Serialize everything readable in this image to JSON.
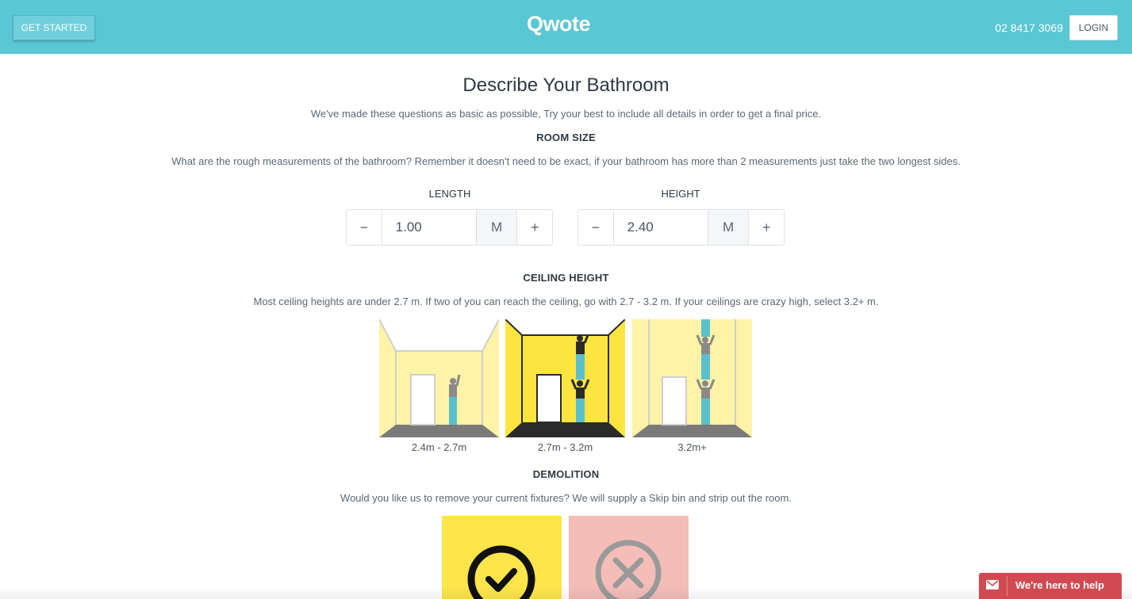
{
  "header": {
    "get_started": "GET STARTED",
    "logo": "Qwote",
    "phone": "02 8417 3069",
    "login": "LOGIN",
    "bg_color": "#5ac7d4"
  },
  "page": {
    "title": "Describe Your Bathroom",
    "subtitle": "We've made these questions as basic as possible, Try your best to include all details in order to get a final price."
  },
  "room_size": {
    "heading": "ROOM SIZE",
    "description": "What are the rough measurements of the bathroom? Remember it doesn't need to be exact, if your bathroom has more than 2 measurements just take the two longest sides.",
    "length": {
      "label": "LENGTH",
      "minus": "−",
      "value": "1.00",
      "unit": "M",
      "plus": "+"
    },
    "height": {
      "label": "HEIGHT",
      "minus": "−",
      "value": "2.40",
      "unit": "M",
      "plus": "+"
    }
  },
  "ceiling_height": {
    "heading": "CEILING HEIGHT",
    "description": "Most ceiling heights are under 2.7 m. If two of you can reach the ceiling, go with 2.7 - 3.2 m. If your ceilings are crazy high, select 3.2+ m.",
    "options": [
      {
        "label": "2.4m - 2.7m",
        "selected": false
      },
      {
        "label": "2.7m - 3.2m",
        "selected": true
      },
      {
        "label": "3.2m+",
        "selected": false
      }
    ]
  },
  "demolition": {
    "heading": "DEMOLITION",
    "description": "Would you like us to remove your current fixtures? We will supply a Skip bin and strip out the room.",
    "options": [
      {
        "icon": "check-circle-icon",
        "color": "#fde54a"
      },
      {
        "icon": "x-circle-icon",
        "color": "#f4bdb8"
      }
    ]
  },
  "help_widget": {
    "label": "We're here to help",
    "color": "#d24a51"
  }
}
